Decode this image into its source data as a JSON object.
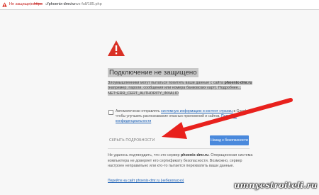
{
  "addressbar": {
    "not_secure": "Не защищено",
    "separator": "|",
    "https": "https",
    "host": "://phoenix-dmr.ru",
    "path": "/news-full/185.php"
  },
  "page": {
    "title": "Подключение не защищено",
    "para1_a": "Злоумышленники могут пытаться похитить ваши данные с сайта ",
    "para1_host": "phoenix-dmr.ru",
    "para1_b": " (например, пароли, сообщения или номера банковских карт). Подробнее...",
    "para1_code": "NET::ERR_CERT_AUTHORITY_INVALID",
    "checkbox_text_a": "Автоматически отправлять ",
    "checkbox_link1": "системную информацию и контент страниц",
    "checkbox_text_b": " в Google, чтобы улучшить распознавание опасных приложений и сайтов. ",
    "checkbox_link2": "Политика конфиденциальности",
    "hide_details": "СКРЫТЬ ПОДРОБНОСТИ",
    "back_button": "Назад к безопасности",
    "para3_a": "Не удалось подтвердить, что это сервер ",
    "para3_host": "phoenix-dmr.ru",
    "para3_b": ". Операционная система компьютера не доверяет его сертификату безопасности. Возможно, сервер настроен неправильно или кто-то пытается перехватить ваши данные.",
    "proceed_link": "Перейти на сайт phoenix-dmr.ru (небезопасно)"
  },
  "watermark": "umnyestroiteli.ru",
  "colors": {
    "warning_red": "#d93025",
    "annotation_arrow": "#e8211d",
    "primary_button": "#4a89dc"
  }
}
